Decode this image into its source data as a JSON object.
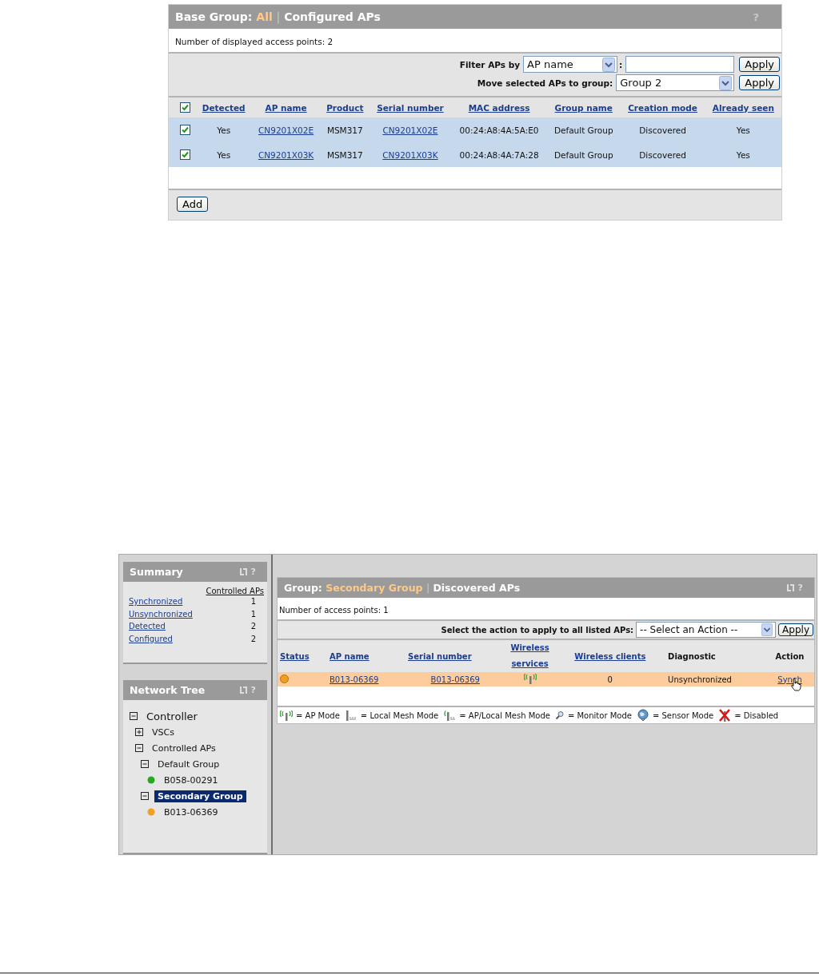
{
  "configured_panel": {
    "title_prefix": "Base Group:",
    "title_group": "All",
    "separator": "|",
    "title_page": "Configured APs",
    "help": "?",
    "count_text": "Number of displayed access points: 2",
    "filter": {
      "label": "Filter APs by",
      "select": "AP name",
      "colon": ":",
      "button": "Apply"
    },
    "move": {
      "label": "Move selected APs to group:",
      "select": "Group 2",
      "button": "Apply"
    },
    "select_all_checked": true,
    "columns": [
      "Detected",
      "AP name",
      "Product",
      "Serial number",
      "MAC address",
      "Group name",
      "Creation mode",
      "Already seen"
    ],
    "rows": [
      {
        "checked": true,
        "cells": [
          "Yes",
          "CN9201X02E",
          "MSM317",
          "CN9201X02E",
          "00:24:A8:4A:5A:E0",
          "Default Group",
          "Discovered",
          "Yes"
        ]
      },
      {
        "checked": true,
        "cells": [
          "Yes",
          "CN9201X03K",
          "MSM317",
          "CN9201X03K",
          "00:24:A8:4A:7A:28",
          "Default Group",
          "Discovered",
          "Yes"
        ]
      }
    ],
    "add_button": "Add"
  },
  "summary": {
    "title": "Summary",
    "help": "?",
    "column": "Controlled APs",
    "rows": [
      {
        "label": "Synchronized",
        "value": "1"
      },
      {
        "label": "Unsynchronized",
        "value": "1"
      },
      {
        "label": "Detected",
        "value": "2"
      },
      {
        "label": "Configured",
        "value": "2"
      }
    ]
  },
  "network_tree": {
    "title": "Network Tree",
    "help": "?",
    "items": [
      {
        "label": "Controller",
        "expanded": true,
        "selected": false,
        "children": [
          {
            "label": "VSCs",
            "expanded": false,
            "selected": false
          },
          {
            "label": "Controlled APs",
            "expanded": true,
            "selected": false,
            "children": [
              {
                "label": "Default Group",
                "expanded": true,
                "selected": false,
                "children": [
                  {
                    "label": "B058-00291",
                    "selected": false,
                    "color": "#22aa22"
                  }
                ]
              },
              {
                "label": "Secondary Group",
                "expanded": true,
                "selected": true,
                "children": [
                  {
                    "label": "B013-06369",
                    "selected": false,
                    "color": "#f0a020"
                  }
                ]
              }
            ]
          }
        ]
      }
    ]
  },
  "discovered_panel": {
    "title_prefix": "Group:",
    "title_group": "Secondary Group",
    "separator": "|",
    "title_page": "Discovered APs",
    "help": "?",
    "count_text": "Number of access points: 1",
    "action_label": "Select the action to apply to all listed APs:",
    "action_select": "-- Select an Action --",
    "action_button": "Apply",
    "columns": [
      {
        "label": "Status",
        "kind": "link"
      },
      {
        "label": "AP name",
        "kind": "link"
      },
      {
        "label": "Serial number",
        "kind": "link"
      },
      {
        "label": "Wireless services",
        "kind": "link"
      },
      {
        "label": "Wireless clients",
        "kind": "link"
      },
      {
        "label": "Diagnostic",
        "kind": "plain"
      },
      {
        "label": "Action",
        "kind": "plain"
      }
    ],
    "rows": [
      {
        "color": "#f0a020",
        "ap_name": "B013-06369",
        "serial": "B013-06369",
        "clients": "0",
        "diagnostic": "Unsynchronized",
        "action": "Synch"
      }
    ],
    "legend": [
      {
        "kind": "ap",
        "text": "= AP Mode"
      },
      {
        "kind": "mesh",
        "text": "= Local Mesh Mode"
      },
      {
        "kind": "ap_mesh",
        "text": "= AP/Local Mesh Mode"
      },
      {
        "kind": "monitor",
        "text": "= Monitor Mode"
      },
      {
        "kind": "sensor",
        "text": "= Sensor Mode"
      },
      {
        "kind": "disabled",
        "text": "= Disabled"
      }
    ]
  }
}
